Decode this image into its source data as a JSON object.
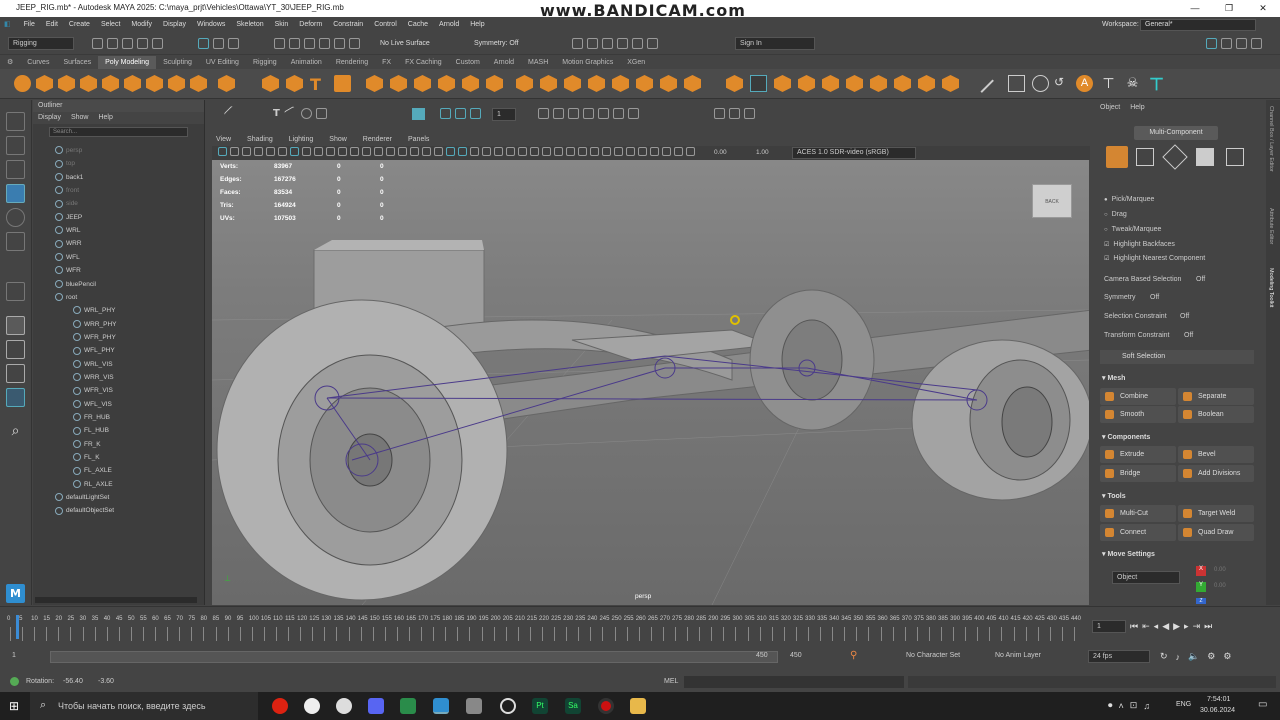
{
  "window": {
    "title": "JEEP_RIG.mb* - Autodesk MAYA 2025: C:\\maya_prjt\\Vehicles\\Ottawa\\YT_30\\JEEP_RIG.mb",
    "watermark": "www.BANDICAM.com"
  },
  "menubar": [
    "File",
    "Edit",
    "Create",
    "Select",
    "Modify",
    "Display",
    "Windows",
    "Skeleton",
    "Skin",
    "Deform",
    "Constrain",
    "Control",
    "Cache",
    "Arnold",
    "Help"
  ],
  "workspace": {
    "label": "Workspace:",
    "value": "General*"
  },
  "statusline": {
    "mode": "Rigging",
    "live_surface": "No Live Surface",
    "symmetry": "Symmetry: Off",
    "sign_in": "Sign In"
  },
  "shelf_tabs": [
    "Curves",
    "Surfaces",
    "Poly Modeling",
    "Sculpting",
    "UV Editing",
    "Rigging",
    "Animation",
    "Rendering",
    "FX",
    "FX Caching",
    "Custom",
    "Arnold",
    "MASH",
    "Motion Graphics",
    "XGen"
  ],
  "shelf_active": "Poly Modeling",
  "outliner": {
    "title": "Outliner",
    "menu": [
      "Display",
      "Show",
      "Help"
    ],
    "search_placeholder": "Search...",
    "items": [
      {
        "label": "persp",
        "dim": true
      },
      {
        "label": "top",
        "dim": true
      },
      {
        "label": "back1",
        "dim": false
      },
      {
        "label": "front",
        "dim": true
      },
      {
        "label": "side",
        "dim": true
      },
      {
        "label": "JEEP",
        "dim": false
      },
      {
        "label": "WRL",
        "dim": false
      },
      {
        "label": "WRR",
        "dim": false
      },
      {
        "label": "WFL",
        "dim": false
      },
      {
        "label": "WFR",
        "dim": false
      },
      {
        "label": "bluePencil",
        "dim": false
      },
      {
        "label": "root",
        "dim": false
      },
      {
        "label": "WRL_PHY",
        "dim": false
      },
      {
        "label": "WRR_PHY",
        "dim": false
      },
      {
        "label": "WFR_PHY",
        "dim": false
      },
      {
        "label": "WFL_PHY",
        "dim": false
      },
      {
        "label": "WRL_VIS",
        "dim": false
      },
      {
        "label": "WRR_VIS",
        "dim": false
      },
      {
        "label": "WFR_VIS",
        "dim": false
      },
      {
        "label": "WFL_VIS",
        "dim": false
      },
      {
        "label": "FR_HUB",
        "dim": false
      },
      {
        "label": "FL_HUB",
        "dim": false
      },
      {
        "label": "FR_K",
        "dim": false
      },
      {
        "label": "FL_K",
        "dim": false
      },
      {
        "label": "FL_AXLE",
        "dim": false
      },
      {
        "label": "RL_AXLE",
        "dim": false
      },
      {
        "label": "defaultLightSet",
        "dim": false
      },
      {
        "label": "defaultObjectSet",
        "dim": false
      }
    ]
  },
  "viewport": {
    "menu": [
      "View",
      "Shading",
      "Lighting",
      "Show",
      "Renderer",
      "Panels"
    ],
    "exposure": "0.00",
    "gamma": "1.00",
    "color_space": "ACES 1.0 SDR-video (sRGB)",
    "camera": "persp",
    "viewcube": "BACK",
    "hud": [
      {
        "label": "Verts:",
        "a": "83967",
        "b": "0",
        "c": "0"
      },
      {
        "label": "Edges:",
        "a": "167276",
        "b": "0",
        "c": "0"
      },
      {
        "label": "Faces:",
        "a": "83534",
        "b": "0",
        "c": "0"
      },
      {
        "label": "Tris:",
        "a": "164924",
        "b": "0",
        "c": "0"
      },
      {
        "label": "UVs:",
        "a": "107503",
        "b": "0",
        "c": "0"
      }
    ]
  },
  "modeling_toolkit": {
    "menu": [
      "Object",
      "Help"
    ],
    "mode": "Multi-Component",
    "options": [
      "Pick/Marquee",
      "Drag",
      "Tweak/Marquee",
      "Highlight Backfaces",
      "Highlight Nearest Component"
    ],
    "camera_based": "Camera Based Selection",
    "symmetry": "Symmetry",
    "selection_constraint": "Selection Constraint",
    "transform_constraint": "Transform Constraint",
    "off": "Off",
    "soft_selection": "Soft Selection",
    "sections": {
      "mesh": "Mesh",
      "components": "Components",
      "tools": "Tools",
      "move": "Move Settings"
    },
    "mesh": [
      "Combine",
      "Separate",
      "Smooth",
      "Boolean"
    ],
    "components": [
      "Extrude",
      "Bevel",
      "Bridge",
      "Add Divisions"
    ],
    "tools": [
      "Multi-Cut",
      "Target Weld",
      "Connect",
      "Quad Draw"
    ],
    "move_object": "Object",
    "axes": [
      "X",
      "Y",
      "Z"
    ],
    "axis_vals": [
      "0.00",
      "0.00",
      "0.00"
    ]
  },
  "side_tabs": [
    "Channel Box / Layer Editor",
    "Attribute Editor",
    "Modeling Toolkit"
  ],
  "timeline": {
    "ticks": [
      "0",
      "5",
      "10",
      "15",
      "20",
      "25",
      "30",
      "35",
      "40",
      "45",
      "50",
      "55",
      "60",
      "65",
      "70",
      "75",
      "80",
      "85",
      "90",
      "95",
      "100",
      "105",
      "110",
      "115",
      "120",
      "125",
      "130",
      "135",
      "140",
      "145",
      "150",
      "155",
      "160",
      "165",
      "170",
      "175",
      "180",
      "185",
      "190",
      "195",
      "200",
      "205",
      "210",
      "215",
      "220",
      "225",
      "230",
      "235",
      "240",
      "245",
      "250",
      "255",
      "260",
      "265",
      "270",
      "275",
      "280",
      "285",
      "290",
      "295",
      "300",
      "305",
      "310",
      "315",
      "320",
      "325",
      "330",
      "335",
      "340",
      "345",
      "350",
      "355",
      "360",
      "365",
      "370",
      "375",
      "380",
      "385",
      "390",
      "395",
      "400",
      "405",
      "410",
      "415",
      "420",
      "425",
      "430",
      "435",
      "440"
    ],
    "current": "1"
  },
  "range": {
    "start": "1",
    "start2": "1",
    "end": "450",
    "end2": "450",
    "character": "No Character Set",
    "anim_layer": "No Anim Layer",
    "fps": "24 fps"
  },
  "cmdline": {
    "rotation_label": "Rotation:",
    "rx": "-56.40",
    "ry": "-3.60",
    "lang": "MEL"
  },
  "taskbar": {
    "search": "Чтобы начать поиск, введите здесь",
    "lang": "ENG",
    "time": "7:54:01",
    "date": "30.06.2024"
  }
}
